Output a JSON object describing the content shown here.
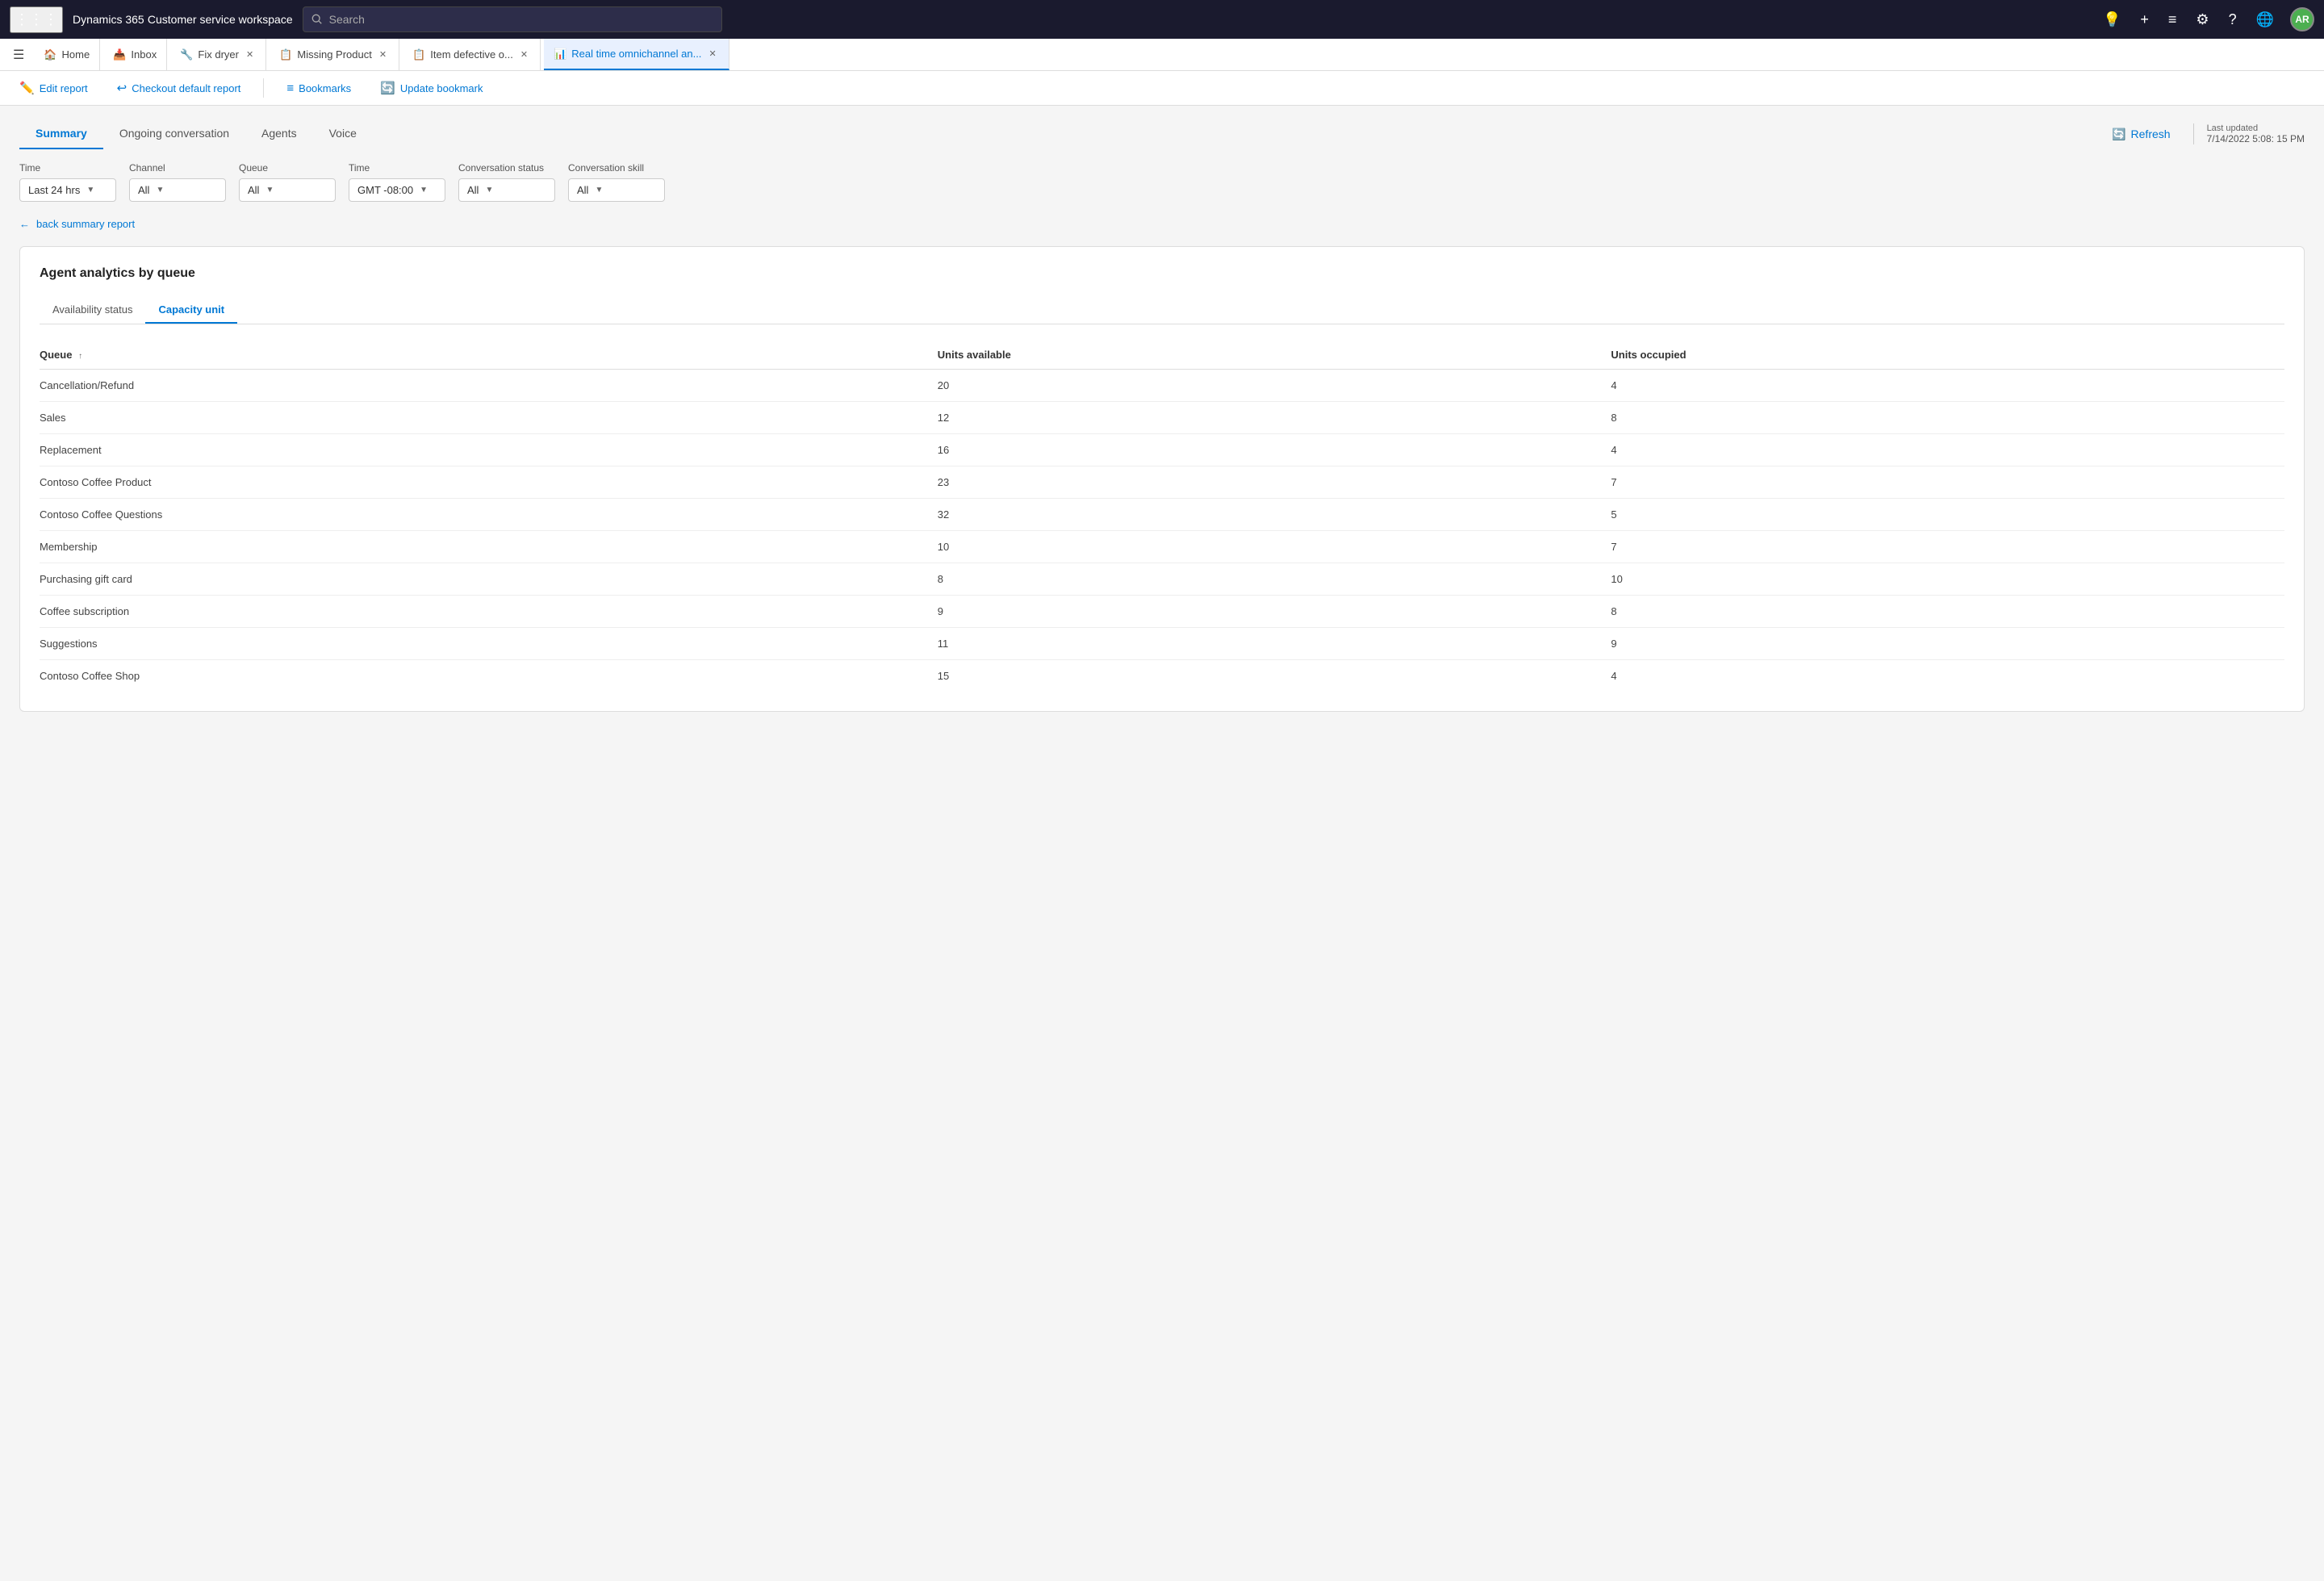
{
  "app": {
    "brand": "Dynamics 365",
    "brand_subtitle": "Customer service workspace",
    "search_placeholder": "Search"
  },
  "top_icons": {
    "lightbulb": "💡",
    "plus": "+",
    "menu": "≡",
    "settings": "⚙",
    "help": "?",
    "globe": "🌐",
    "avatar_initials": "AR"
  },
  "tabs": [
    {
      "id": "home",
      "label": "Home",
      "icon": "🏠",
      "closable": false,
      "active": false
    },
    {
      "id": "inbox",
      "label": "Inbox",
      "icon": "📥",
      "closable": false,
      "active": false
    },
    {
      "id": "fix-dryer",
      "label": "Fix dryer",
      "icon": "🔧",
      "closable": true,
      "active": false
    },
    {
      "id": "missing-product",
      "label": "Missing Product",
      "icon": "📋",
      "closable": true,
      "active": false
    },
    {
      "id": "item-defective",
      "label": "Item defective o...",
      "icon": "📋",
      "closable": true,
      "active": false
    },
    {
      "id": "real-time",
      "label": "Real time omnichannel an...",
      "icon": "📊",
      "closable": true,
      "active": true
    }
  ],
  "toolbar": {
    "edit_report_label": "Edit report",
    "checkout_label": "Checkout default report",
    "bookmarks_label": "Bookmarks",
    "update_bookmark_label": "Update bookmark"
  },
  "report": {
    "tabs": [
      {
        "id": "summary",
        "label": "Summary",
        "active": true
      },
      {
        "id": "ongoing",
        "label": "Ongoing conversation",
        "active": false
      },
      {
        "id": "agents",
        "label": "Agents",
        "active": false
      },
      {
        "id": "voice",
        "label": "Voice",
        "active": false
      }
    ],
    "refresh_label": "Refresh",
    "last_updated_label": "Last updated",
    "last_updated_value": "7/14/2022 5:08: 15 PM"
  },
  "filters": [
    {
      "id": "time1",
      "label": "Time",
      "value": "Last 24 hrs"
    },
    {
      "id": "channel",
      "label": "Channel",
      "value": "All"
    },
    {
      "id": "queue",
      "label": "Queue",
      "value": "All"
    },
    {
      "id": "time2",
      "label": "Time",
      "value": "GMT -08:00"
    },
    {
      "id": "conv_status",
      "label": "Conversation status",
      "value": "All"
    },
    {
      "id": "conv_skill",
      "label": "Conversation skill",
      "value": "All"
    }
  ],
  "back_link": "back summary report",
  "card": {
    "title": "Agent analytics by queue",
    "inner_tabs": [
      {
        "id": "availability",
        "label": "Availability status",
        "active": false
      },
      {
        "id": "capacity",
        "label": "Capacity unit",
        "active": true
      }
    ],
    "table": {
      "columns": [
        {
          "id": "queue",
          "label": "Queue",
          "sortable": true
        },
        {
          "id": "units_available",
          "label": "Units available",
          "sortable": false
        },
        {
          "id": "units_occupied",
          "label": "Units occupied",
          "sortable": false
        }
      ],
      "rows": [
        {
          "queue": "Cancellation/Refund",
          "units_available": "20",
          "units_occupied": "4"
        },
        {
          "queue": "Sales",
          "units_available": "12",
          "units_occupied": "8"
        },
        {
          "queue": "Replacement",
          "units_available": "16",
          "units_occupied": "4"
        },
        {
          "queue": "Contoso Coffee Product",
          "units_available": "23",
          "units_occupied": "7"
        },
        {
          "queue": "Contoso Coffee Questions",
          "units_available": "32",
          "units_occupied": "5"
        },
        {
          "queue": "Membership",
          "units_available": "10",
          "units_occupied": "7"
        },
        {
          "queue": "Purchasing gift card",
          "units_available": "8",
          "units_occupied": "10"
        },
        {
          "queue": "Coffee subscription",
          "units_available": "9",
          "units_occupied": "8"
        },
        {
          "queue": "Suggestions",
          "units_available": "11",
          "units_occupied": "9"
        },
        {
          "queue": "Contoso Coffee Shop",
          "units_available": "15",
          "units_occupied": "4"
        }
      ]
    }
  }
}
